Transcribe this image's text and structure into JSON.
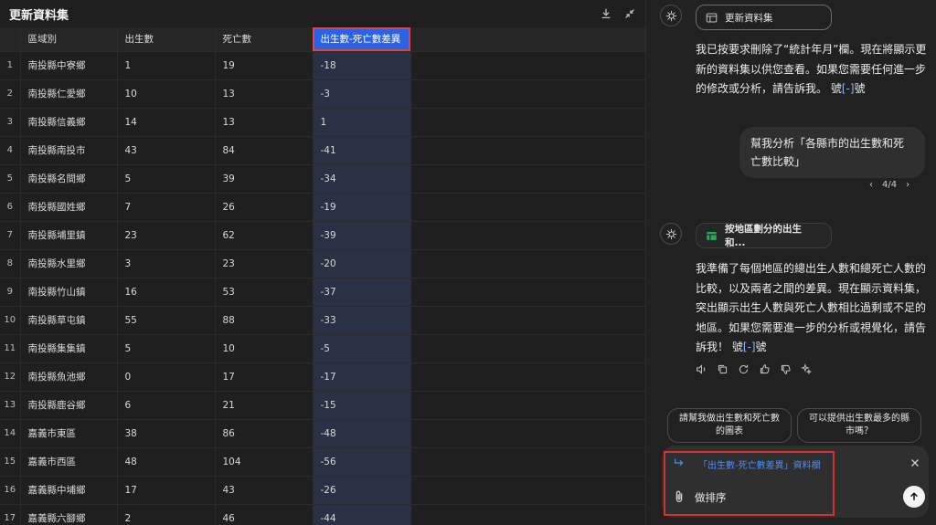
{
  "dataset": {
    "title": "更新資料集",
    "columns": [
      "區域別",
      "出生數",
      "死亡數",
      "出生數-死亡數差異"
    ],
    "rows": [
      [
        "1",
        "南投縣中寮鄉",
        "1",
        "19",
        "-18"
      ],
      [
        "2",
        "南投縣仁愛鄉",
        "10",
        "13",
        "-3"
      ],
      [
        "3",
        "南投縣信義鄉",
        "14",
        "13",
        "1"
      ],
      [
        "4",
        "南投縣南投市",
        "43",
        "84",
        "-41"
      ],
      [
        "5",
        "南投縣名間鄉",
        "5",
        "39",
        "-34"
      ],
      [
        "6",
        "南投縣國姓鄉",
        "7",
        "26",
        "-19"
      ],
      [
        "7",
        "南投縣埔里鎮",
        "23",
        "62",
        "-39"
      ],
      [
        "8",
        "南投縣水里鄉",
        "3",
        "23",
        "-20"
      ],
      [
        "9",
        "南投縣竹山鎮",
        "16",
        "53",
        "-37"
      ],
      [
        "10",
        "南投縣草屯鎮",
        "55",
        "88",
        "-33"
      ],
      [
        "11",
        "南投縣集集鎮",
        "5",
        "10",
        "-5"
      ],
      [
        "12",
        "南投縣魚池鄉",
        "0",
        "17",
        "-17"
      ],
      [
        "13",
        "南投縣鹿谷鄉",
        "6",
        "21",
        "-15"
      ],
      [
        "14",
        "嘉義市東區",
        "38",
        "86",
        "-48"
      ],
      [
        "15",
        "嘉義市西區",
        "48",
        "104",
        "-56"
      ],
      [
        "16",
        "嘉義縣中埔鄉",
        "17",
        "43",
        "-26"
      ],
      [
        "17",
        "嘉義縣六腳鄉",
        "2",
        "46",
        "-44"
      ]
    ]
  },
  "chat": {
    "chip1_label": "更新資料集",
    "msg1_text": "我已按要求刪除了“統計年月”欄。現在將顯示更新的資料集以供您查看。如果您需要任何進一步的修改或分析，請告訴我。 號",
    "msg1_ref": "[-]",
    "msg1_tail": "號",
    "user_msg": "幫我分析「各縣市的出生數和死亡數比較」",
    "pager": "4/4",
    "chip2_label": "按地區劃分的出生和...",
    "msg2_text": "我準備了每個地區的總出生人數和總死亡人數的比較，以及兩者之間的差異。現在顯示資料集，突出顯示出生人數與死亡人數相比過剩或不足的地區。如果您需要進一步的分析或視覺化，請告訴我！ 號",
    "msg2_ref": "[-]",
    "msg2_tail": "號",
    "suggestion1": "請幫我做出生數和死亡數的圖表",
    "suggestion2": "可以提供出生數最多的縣市嗎？",
    "quote": "「出生數-死亡數差異」資料欄",
    "input_value": "做排序"
  },
  "colors": {
    "accent": "#2b63e6",
    "highlight_column": "#2a3145",
    "annotation_red": "#d8302c",
    "link_blue": "#4c8df6"
  }
}
